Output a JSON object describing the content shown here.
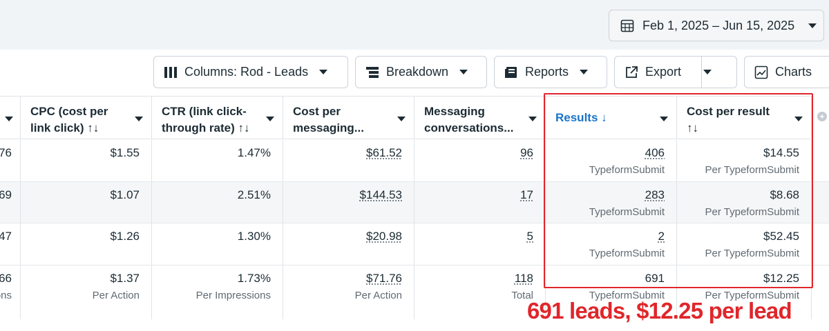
{
  "date_range": {
    "label": "Feb 1, 2025 – Jun 15, 2025",
    "icon": "calendar-icon"
  },
  "toolbar": {
    "columns_label": "Columns: Rod - Leads",
    "breakdown_label": "Breakdown",
    "reports_label": "Reports",
    "export_label": "Export",
    "charts_label": "Charts"
  },
  "table": {
    "headers": [
      {
        "line1": "CPC (cost per",
        "line2": "link click) ↑↓"
      },
      {
        "line1": "CTR (link click-",
        "line2": "through rate) ↑↓"
      },
      {
        "line1": "Cost per",
        "line2": "messaging..."
      },
      {
        "line1": "Messaging",
        "line2": "conversations..."
      },
      {
        "line1": "Results ↓",
        "line2": ""
      },
      {
        "line1": "Cost per result",
        "line2": "↑↓"
      }
    ],
    "rows": [
      {
        "partial": "76",
        "partial_sub": "",
        "cpc": "$1.55",
        "ctr": "1.47%",
        "cost_msg": "$61.52",
        "msg_conv": "96",
        "results": "406",
        "results_sub": "TypeformSubmit",
        "cpr": "$14.55",
        "cpr_sub": "Per TypeformSubmit"
      },
      {
        "partial": "69",
        "partial_sub": "",
        "cpc": "$1.07",
        "ctr": "2.51%",
        "cost_msg": "$144.53",
        "msg_conv": "17",
        "results": "283",
        "results_sub": "TypeformSubmit",
        "cpr": "$8.68",
        "cpr_sub": "Per TypeformSubmit"
      },
      {
        "partial": "47",
        "partial_sub": "",
        "cpc": "$1.26",
        "ctr": "1.30%",
        "cost_msg": "$20.98",
        "msg_conv": "5",
        "results": "2",
        "results_sub": "TypeformSubmit",
        "cpr": "$52.45",
        "cpr_sub": "Per TypeformSubmit"
      }
    ],
    "total": {
      "partial": "66",
      "partial_sub": "ons",
      "cpc": "$1.37",
      "cpc_sub": "Per Action",
      "ctr": "1.73%",
      "ctr_sub": "Per Impressions",
      "cost_msg": "$71.76",
      "cost_msg_sub": "Per Action",
      "msg_conv": "118",
      "msg_conv_sub": "Total",
      "results": "691",
      "results_sub": "TypeformSubmit",
      "cpr": "$12.25",
      "cpr_sub": "Per TypeformSubmit"
    }
  },
  "annotation": "691 leads, $12.25 per lead",
  "colors": {
    "highlight": "#e0262b",
    "sort_active": "#1a73c8"
  }
}
